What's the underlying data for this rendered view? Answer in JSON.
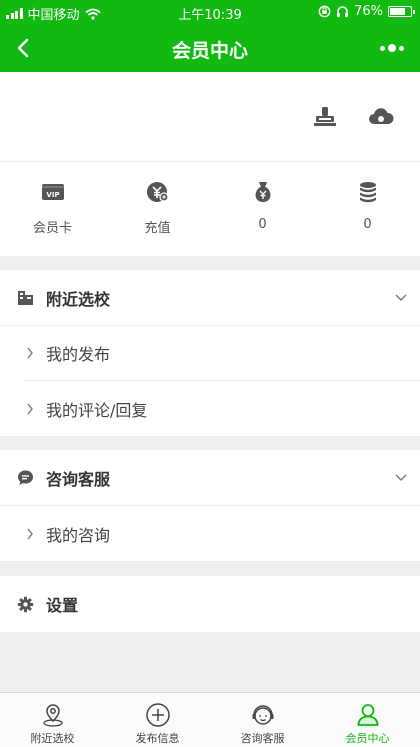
{
  "status_bar": {
    "carrier": "中国移动",
    "time": "上午10:39",
    "battery": "76%",
    "battery_level": 0.76
  },
  "nav": {
    "title": "会员中心"
  },
  "stats": [
    {
      "label": "会员卡",
      "icon": "vip-card-icon"
    },
    {
      "label": "充值",
      "icon": "recharge-icon"
    },
    {
      "label": "0",
      "icon": "money-bag-icon"
    },
    {
      "label": "0",
      "icon": "coin-stack-icon"
    }
  ],
  "sections": {
    "nearby": {
      "title": "附近选校",
      "items": [
        "我的发布",
        "我的评论/回复"
      ]
    },
    "consult": {
      "title": "咨询客服",
      "items": [
        "我的咨询"
      ]
    },
    "settings": {
      "title": "设置"
    }
  },
  "tabs": [
    {
      "label": "附近选校",
      "icon": "map-pin-icon"
    },
    {
      "label": "发布信息",
      "icon": "plus-circle-icon"
    },
    {
      "label": "咨询客服",
      "icon": "service-agent-icon"
    },
    {
      "label": "会员中心",
      "icon": "user-icon"
    }
  ],
  "colors": {
    "accent": "#11b911",
    "icon_gray": "#555555",
    "background": "#efefef"
  }
}
